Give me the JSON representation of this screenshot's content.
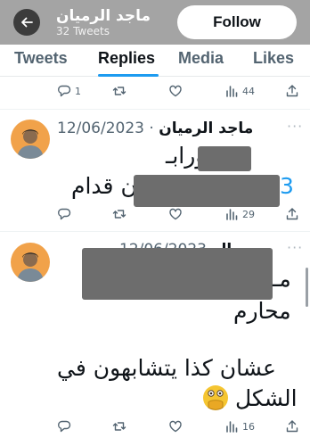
{
  "header": {
    "title": "ماجد الرميان",
    "subtitle": "32 Tweets",
    "follow_label": "Follow"
  },
  "tabs": [
    {
      "label": "Tweets"
    },
    {
      "label": "Replies"
    },
    {
      "label": "Media"
    },
    {
      "label": "Likes"
    }
  ],
  "active_tab": "Replies",
  "top_actions": {
    "reply_count": "1",
    "views": "44"
  },
  "tweet1": {
    "author": "ماجد الرميان",
    "date": "12/06/2023",
    "line1_a": "بـ",
    "line1_b": "ن ورا",
    "line2_mention": "3",
    "line2_b": "ن قدام",
    "views": "29"
  },
  "tweet2": {
    "author_fragment": "الر",
    "date_fragment": "12/06/2023",
    "line1": "مـ",
    "line2": "محارم",
    "line3": "عشان كذا يتشابهون في",
    "line4": "الشكل",
    "views": "16"
  },
  "colors": {
    "header_bg": "#a4a4a4",
    "accent": "#1d9bf0",
    "redaction": "#6d6d6d",
    "muted": "#536471"
  },
  "icons": [
    "back-arrow-icon",
    "reply-icon",
    "retweet-icon",
    "like-icon",
    "views-icon",
    "share-icon",
    "more-icon",
    "face-with-hand-over-mouth-emoji"
  ]
}
